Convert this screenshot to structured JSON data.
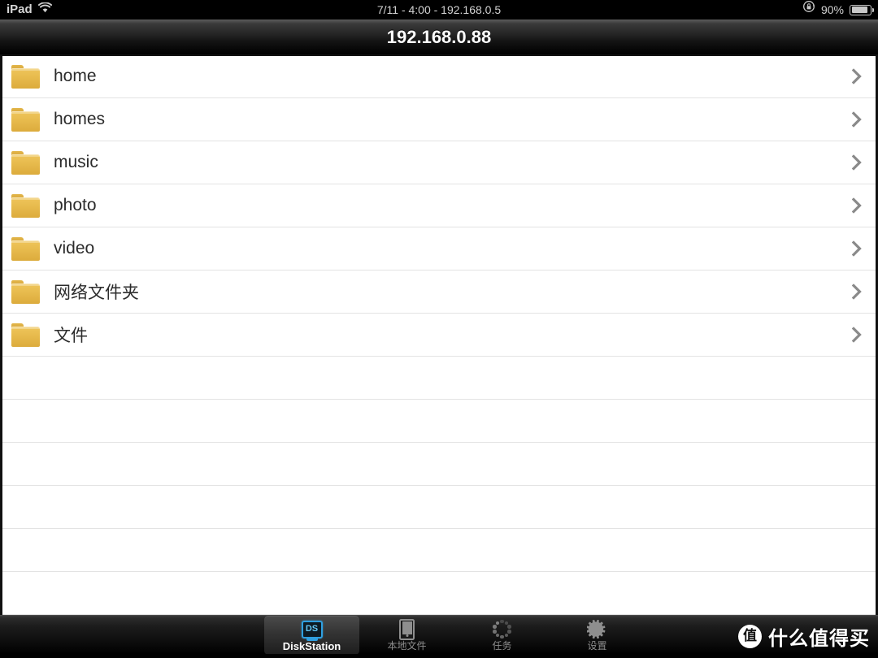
{
  "statusbar": {
    "carrier": "iPad",
    "wifi_icon": "wifi-icon",
    "center_text": "7/11 - 4:00 - 192.168.0.5",
    "rotation_lock_icon": "rotation-lock-icon",
    "battery_percent": "90%",
    "battery_icon": "battery-icon"
  },
  "navbar": {
    "title": "192.168.0.88"
  },
  "list": {
    "rows": [
      {
        "label": "home",
        "icon": "folder-icon",
        "chevron": "chevron-right-icon",
        "cjk": false
      },
      {
        "label": "homes",
        "icon": "folder-icon",
        "chevron": "chevron-right-icon",
        "cjk": false
      },
      {
        "label": "music",
        "icon": "folder-icon",
        "chevron": "chevron-right-icon",
        "cjk": false
      },
      {
        "label": "photo",
        "icon": "folder-icon",
        "chevron": "chevron-right-icon",
        "cjk": false
      },
      {
        "label": "video",
        "icon": "folder-icon",
        "chevron": "chevron-right-icon",
        "cjk": false
      },
      {
        "label": "网络文件夹",
        "icon": "folder-icon",
        "chevron": "chevron-right-icon",
        "cjk": true
      },
      {
        "label": "文件",
        "icon": "folder-icon",
        "chevron": "chevron-right-icon",
        "cjk": true
      }
    ],
    "empty_row_count": 6
  },
  "tabbar": {
    "items": [
      {
        "label": "DiskStation",
        "icon": "diskstation-icon",
        "selected": true
      },
      {
        "label": "本地文件",
        "icon": "device-icon",
        "selected": false
      },
      {
        "label": "任务",
        "icon": "tasks-spinner-icon",
        "selected": false
      },
      {
        "label": "设置",
        "icon": "gear-icon",
        "selected": false
      }
    ],
    "ds_badge_text": "DS"
  },
  "watermark": {
    "logo_char": "值",
    "text": "什么值得买"
  },
  "colors": {
    "folder_yellow": "#e9bd50",
    "accent_blue": "#2f9fe0",
    "row_separator": "#e3e3e3",
    "text_primary": "#2b2b2b"
  }
}
